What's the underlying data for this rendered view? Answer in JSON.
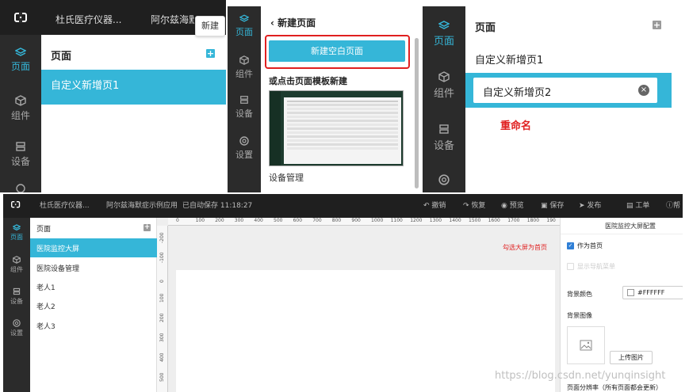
{
  "panel1": {
    "tabs": [
      "杜氏医疗仪器...",
      "阿尔兹海默"
    ],
    "tooltip": "新建",
    "rail": [
      {
        "label": "页面",
        "icon": "layers-icon"
      },
      {
        "label": "组件",
        "icon": "cube-icon"
      },
      {
        "label": "设备",
        "icon": "device-icon"
      }
    ],
    "header": "页面",
    "items": [
      "自定义新增页1"
    ]
  },
  "panel2": {
    "rail": [
      {
        "label": "页面",
        "icon": "layers-icon"
      },
      {
        "label": "组件",
        "icon": "cube-icon"
      },
      {
        "label": "设备",
        "icon": "device-icon"
      },
      {
        "label": "设置",
        "icon": "settings-icon"
      }
    ],
    "back_title": "新建页面",
    "new_blank_button": "新建空白页面",
    "template_heading": "或点击页面模板新建",
    "template_name": "设备管理"
  },
  "panel3": {
    "rail": [
      {
        "label": "页面",
        "icon": "layers-icon"
      },
      {
        "label": "组件",
        "icon": "cube-icon"
      },
      {
        "label": "设备",
        "icon": "device-icon"
      }
    ],
    "header": "页面",
    "items": [
      "自定义新增页1"
    ],
    "rename_value": "自定义新增页2",
    "annotation": "重命名"
  },
  "editor": {
    "tabs": [
      "杜氏医疗仪器...",
      "阿尔兹海默症示例应用"
    ],
    "autosave": "已自动保存 11:18:27",
    "toolbar": [
      {
        "label": "撤销",
        "icon": "undo-icon"
      },
      {
        "label": "恢复",
        "icon": "redo-icon"
      },
      {
        "label": "预览",
        "icon": "eye-icon"
      },
      {
        "label": "保存",
        "icon": "save-icon"
      },
      {
        "label": "发布",
        "icon": "send-icon"
      },
      {
        "label": "工单",
        "icon": "ticket-icon"
      },
      {
        "label": "帮",
        "icon": "help-icon"
      }
    ],
    "rail": [
      {
        "label": "页面",
        "icon": "layers-icon"
      },
      {
        "label": "组件",
        "icon": "cube-icon"
      },
      {
        "label": "设备",
        "icon": "device-icon"
      },
      {
        "label": "设置",
        "icon": "settings-icon"
      }
    ],
    "pages_header": "页面",
    "pages": [
      "医院监控大屏",
      "医院设备管理",
      "老人1",
      "老人2",
      "老人3"
    ],
    "ruler_ticks": [
      "0",
      "100",
      "200",
      "300",
      "400",
      "500",
      "600",
      "700",
      "800",
      "900",
      "1000",
      "1100",
      "1200",
      "1300",
      "1400",
      "1500",
      "1600",
      "1700",
      "1800",
      "190"
    ],
    "vruler_ticks": [
      "-200",
      "-100",
      "0",
      "100",
      "200",
      "300",
      "400",
      "500"
    ],
    "canvas_annotation": "勾选大屏为首页",
    "config_title": "医院监控大屏配置",
    "homepage_checkbox": "作为首页",
    "nav_checkbox": "显示导航菜单",
    "bg_color_label": "背景颜色",
    "bg_color_value": "#FFFFFF",
    "bg_image_label": "背景图像",
    "upload_button": "上传图片",
    "footer_partial": "页面分辨率（所有页面都会更新）",
    "watermark": "https://blog.csdn.net/yunqinsight"
  },
  "colors": {
    "accent": "#35b6d8",
    "rail": "#2b2b2b",
    "topbar": "#1f1f1f",
    "red": "#e02020"
  }
}
